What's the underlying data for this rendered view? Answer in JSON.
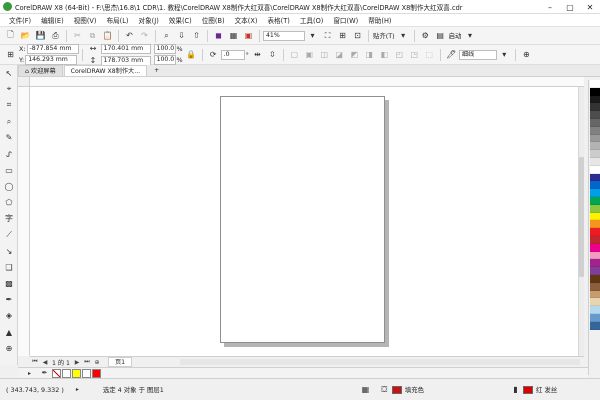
{
  "titlebar": {
    "title": "CorelDRAW X8 (64-Bit) - F:\\思杰\\16.8\\1 CDR\\1. 教程\\CorelDRAW X8制作大红双喜\\CorelDRAW X8制作大红双喜\\CorelDRAW X8制作大红双喜.cdr",
    "minimize": "–",
    "maximize": "▢",
    "close": "✕"
  },
  "menu": [
    "文件(F)",
    "编辑(E)",
    "视图(V)",
    "布局(L)",
    "对象(J)",
    "效果(C)",
    "位图(B)",
    "文本(X)",
    "表格(T)",
    "工具(O)",
    "窗口(W)",
    "帮助(H)"
  ],
  "toolbar1": {
    "zoom_value": "41%",
    "snap_label": "贴齐(T)",
    "launch_label": "启动"
  },
  "toolbar2": {
    "x_label": "X:",
    "x_value": "-877.854 mm",
    "y_label": "Y:",
    "y_value": "146.293 mm",
    "w_value": "170.401 mm",
    "h_value": "178.703 mm",
    "sx_value": "100.0",
    "sy_value": "100.0",
    "percent": "%",
    "angle_value": ".0",
    "angle_unit": "°",
    "outline_value": "细线"
  },
  "tabs": [
    {
      "label": "欢迎屏幕",
      "active": false
    },
    {
      "label": "CorelDRAW X8制作大...",
      "active": true
    }
  ],
  "tab_add": "+",
  "pagenav": {
    "page_label": "1 的 1",
    "page_tab": "页1"
  },
  "status": {
    "coords": "( 343.743, 9.332 )",
    "selection": "选定 4 对象 于 图层1",
    "fill_label": "填充色",
    "outline_label": "红 发丝"
  },
  "colors": {
    "fill_swatch": "#cc1111",
    "outline_swatch": "#dd0000"
  },
  "palette_colors": [
    "#ffffff",
    "#000000",
    "#1a1a1a",
    "#333333",
    "#4d4d4d",
    "#666666",
    "#808080",
    "#999999",
    "#b3b3b3",
    "#cccccc",
    "#e6e6e6",
    "#ffffff",
    "#2d2c8f",
    "#0066cc",
    "#00a0e9",
    "#00a651",
    "#8cc63f",
    "#fff200",
    "#f7941d",
    "#ed1c24",
    "#c1272d",
    "#ec008c",
    "#f49ac1",
    "#a3238e",
    "#7f3f98",
    "#603913",
    "#8b5e3c",
    "#c69c6d",
    "#e8d4b0",
    "#b3d9f0",
    "#6699cc",
    "#336699"
  ],
  "doc_palette": [
    "#ffffff",
    "#ffff00",
    "#ffffff",
    "#ff0000"
  ]
}
